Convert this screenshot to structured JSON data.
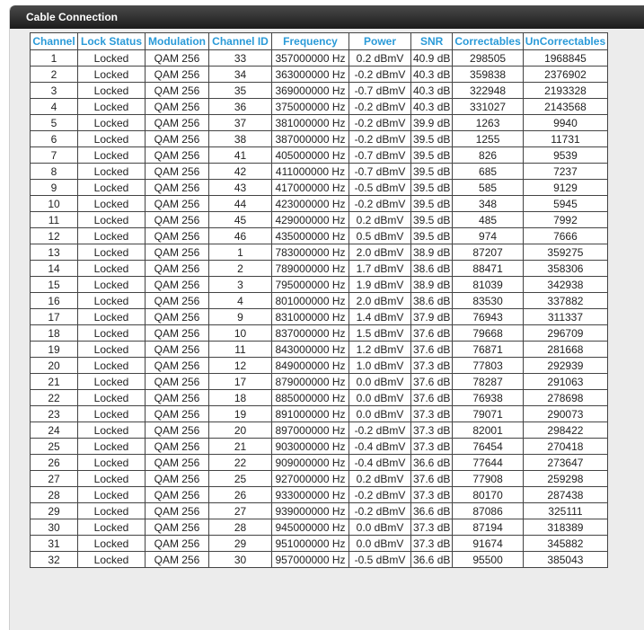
{
  "panel": {
    "title": "Cable Connection"
  },
  "table": {
    "headers": [
      "Channel",
      "Lock Status",
      "Modulation",
      "Channel ID",
      "Frequency",
      "Power",
      "SNR",
      "Correctables",
      "UnCorrectables"
    ],
    "rows": [
      [
        "1",
        "Locked",
        "QAM 256",
        "33",
        "357000000 Hz",
        "0.2 dBmV",
        "40.9 dB",
        "298505",
        "1968845"
      ],
      [
        "2",
        "Locked",
        "QAM 256",
        "34",
        "363000000 Hz",
        "-0.2 dBmV",
        "40.3 dB",
        "359838",
        "2376902"
      ],
      [
        "3",
        "Locked",
        "QAM 256",
        "35",
        "369000000 Hz",
        "-0.7 dBmV",
        "40.3 dB",
        "322948",
        "2193328"
      ],
      [
        "4",
        "Locked",
        "QAM 256",
        "36",
        "375000000 Hz",
        "-0.2 dBmV",
        "40.3 dB",
        "331027",
        "2143568"
      ],
      [
        "5",
        "Locked",
        "QAM 256",
        "37",
        "381000000 Hz",
        "-0.2 dBmV",
        "39.9 dB",
        "1263",
        "9940"
      ],
      [
        "6",
        "Locked",
        "QAM 256",
        "38",
        "387000000 Hz",
        "-0.2 dBmV",
        "39.5 dB",
        "1255",
        "11731"
      ],
      [
        "7",
        "Locked",
        "QAM 256",
        "41",
        "405000000 Hz",
        "-0.7 dBmV",
        "39.5 dB",
        "826",
        "9539"
      ],
      [
        "8",
        "Locked",
        "QAM 256",
        "42",
        "411000000 Hz",
        "-0.7 dBmV",
        "39.5 dB",
        "685",
        "7237"
      ],
      [
        "9",
        "Locked",
        "QAM 256",
        "43",
        "417000000 Hz",
        "-0.5 dBmV",
        "39.5 dB",
        "585",
        "9129"
      ],
      [
        "10",
        "Locked",
        "QAM 256",
        "44",
        "423000000 Hz",
        "-0.2 dBmV",
        "39.5 dB",
        "348",
        "5945"
      ],
      [
        "11",
        "Locked",
        "QAM 256",
        "45",
        "429000000 Hz",
        "0.2 dBmV",
        "39.5 dB",
        "485",
        "7992"
      ],
      [
        "12",
        "Locked",
        "QAM 256",
        "46",
        "435000000 Hz",
        "0.5 dBmV",
        "39.5 dB",
        "974",
        "7666"
      ],
      [
        "13",
        "Locked",
        "QAM 256",
        "1",
        "783000000 Hz",
        "2.0 dBmV",
        "38.9 dB",
        "87207",
        "359275"
      ],
      [
        "14",
        "Locked",
        "QAM 256",
        "2",
        "789000000 Hz",
        "1.7 dBmV",
        "38.6 dB",
        "88471",
        "358306"
      ],
      [
        "15",
        "Locked",
        "QAM 256",
        "3",
        "795000000 Hz",
        "1.9 dBmV",
        "38.9 dB",
        "81039",
        "342938"
      ],
      [
        "16",
        "Locked",
        "QAM 256",
        "4",
        "801000000 Hz",
        "2.0 dBmV",
        "38.6 dB",
        "83530",
        "337882"
      ],
      [
        "17",
        "Locked",
        "QAM 256",
        "9",
        "831000000 Hz",
        "1.4 dBmV",
        "37.9 dB",
        "76943",
        "311337"
      ],
      [
        "18",
        "Locked",
        "QAM 256",
        "10",
        "837000000 Hz",
        "1.5 dBmV",
        "37.6 dB",
        "79668",
        "296709"
      ],
      [
        "19",
        "Locked",
        "QAM 256",
        "11",
        "843000000 Hz",
        "1.2 dBmV",
        "37.6 dB",
        "76871",
        "281668"
      ],
      [
        "20",
        "Locked",
        "QAM 256",
        "12",
        "849000000 Hz",
        "1.0 dBmV",
        "37.3 dB",
        "77803",
        "292939"
      ],
      [
        "21",
        "Locked",
        "QAM 256",
        "17",
        "879000000 Hz",
        "0.0 dBmV",
        "37.6 dB",
        "78287",
        "291063"
      ],
      [
        "22",
        "Locked",
        "QAM 256",
        "18",
        "885000000 Hz",
        "0.0 dBmV",
        "37.6 dB",
        "76938",
        "278698"
      ],
      [
        "23",
        "Locked",
        "QAM 256",
        "19",
        "891000000 Hz",
        "0.0 dBmV",
        "37.3 dB",
        "79071",
        "290073"
      ],
      [
        "24",
        "Locked",
        "QAM 256",
        "20",
        "897000000 Hz",
        "-0.2 dBmV",
        "37.3 dB",
        "82001",
        "298422"
      ],
      [
        "25",
        "Locked",
        "QAM 256",
        "21",
        "903000000 Hz",
        "-0.4 dBmV",
        "37.3 dB",
        "76454",
        "270418"
      ],
      [
        "26",
        "Locked",
        "QAM 256",
        "22",
        "909000000 Hz",
        "-0.4 dBmV",
        "36.6 dB",
        "77644",
        "273647"
      ],
      [
        "27",
        "Locked",
        "QAM 256",
        "25",
        "927000000 Hz",
        "0.2 dBmV",
        "37.6 dB",
        "77908",
        "259298"
      ],
      [
        "28",
        "Locked",
        "QAM 256",
        "26",
        "933000000 Hz",
        "-0.2 dBmV",
        "37.3 dB",
        "80170",
        "287438"
      ],
      [
        "29",
        "Locked",
        "QAM 256",
        "27",
        "939000000 Hz",
        "-0.2 dBmV",
        "36.6 dB",
        "87086",
        "325111"
      ],
      [
        "30",
        "Locked",
        "QAM 256",
        "28",
        "945000000 Hz",
        "0.0 dBmV",
        "37.3 dB",
        "87194",
        "318389"
      ],
      [
        "31",
        "Locked",
        "QAM 256",
        "29",
        "951000000 Hz",
        "0.0 dBmV",
        "37.3 dB",
        "91674",
        "345882"
      ],
      [
        "32",
        "Locked",
        "QAM 256",
        "30",
        "957000000 Hz",
        "-0.5 dBmV",
        "36.6 dB",
        "95500",
        "385043"
      ]
    ]
  },
  "colors": {
    "header_text": "#2a9ad8",
    "panel_header_bg": "#2b2b2b",
    "panel_bg": "#ececec"
  }
}
